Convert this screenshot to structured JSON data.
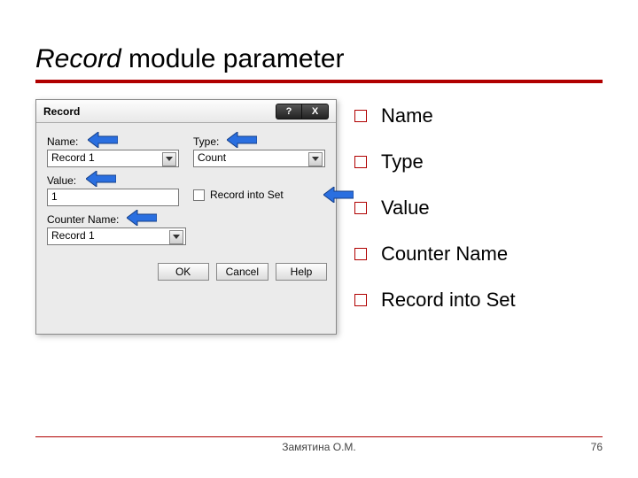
{
  "title_italic": "Record",
  "title_rest": " module parameter",
  "dialog": {
    "title": "Record",
    "labels": {
      "name": "Name:",
      "type": "Type:",
      "value": "Value:",
      "counter": "Counter Name:",
      "record_into_set": "Record into Set"
    },
    "values": {
      "name": "Record 1",
      "type": "Count",
      "value": "1",
      "counter": "Record 1"
    },
    "buttons": {
      "ok": "OK",
      "cancel": "Cancel",
      "help": "Help"
    },
    "win": {
      "help": "?",
      "close": "X"
    }
  },
  "bullets": [
    "Name",
    "Type",
    "Value",
    "Counter Name",
    "Record into Set"
  ],
  "footer": {
    "author": "Замятина О.М.",
    "page": "76"
  }
}
